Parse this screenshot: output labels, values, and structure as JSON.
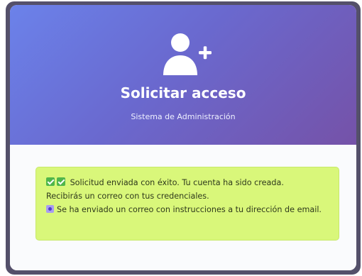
{
  "header": {
    "icon": "user-plus-icon",
    "title": "Solicitar acceso",
    "subtitle": "Sistema de Administración"
  },
  "alert": {
    "line1": "Solicitud enviada con éxito. Tu cuenta ha sido creada.",
    "line2": "Recibirás un correo con tus credenciales.",
    "line3": "Se ha enviado un correo con instrucciones a tu dirección de email.",
    "icons": [
      "check-icon",
      "check-icon",
      "mail-dot-icon"
    ],
    "background_color": "#d9f77a"
  },
  "colors": {
    "header_gradient_start": "#6b82ea",
    "header_gradient_end": "#7552a8",
    "body_background": "#fafbfd"
  }
}
